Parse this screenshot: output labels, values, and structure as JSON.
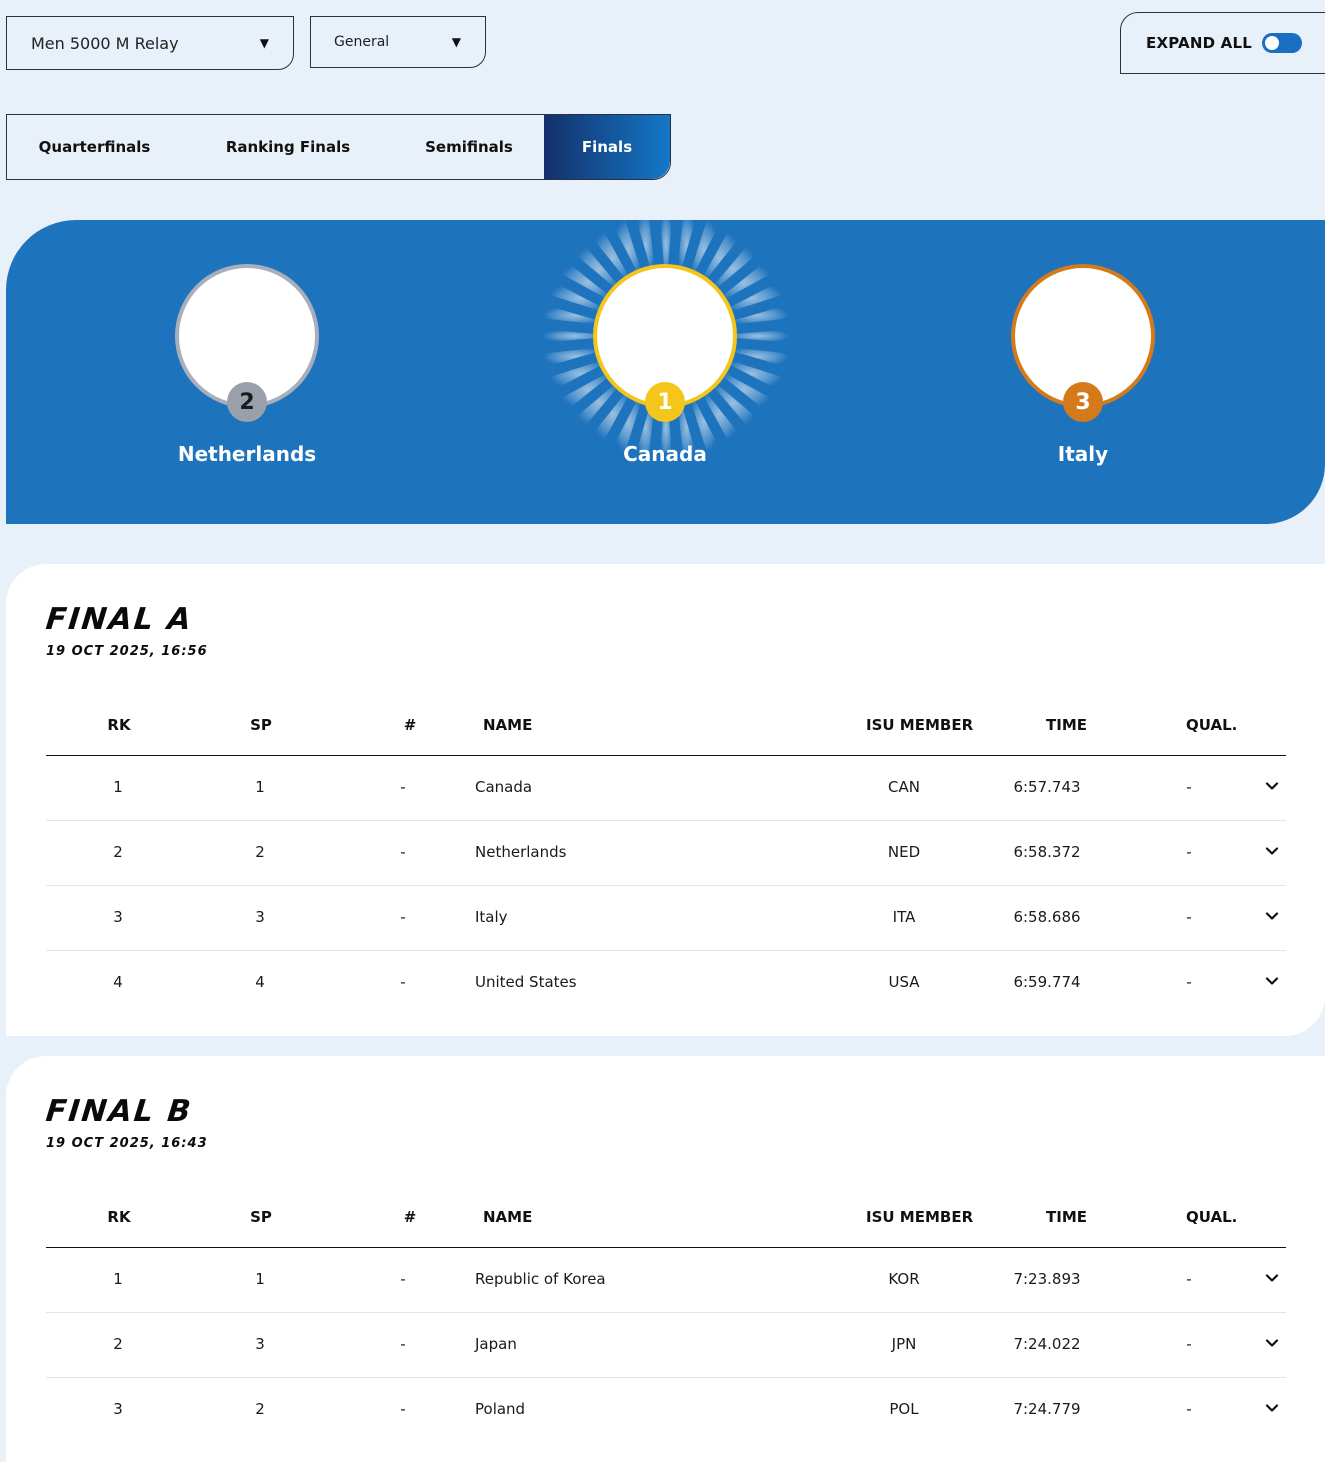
{
  "filters": {
    "event": "Men 5000 M Relay",
    "type": "General"
  },
  "expand_all": {
    "label": "EXPAND ALL",
    "on": true
  },
  "tabs": [
    "Quarterfinals",
    "Ranking Finals",
    "Semifinals",
    "Finals"
  ],
  "active_tab": "Finals",
  "podium": {
    "first": {
      "rank": "1",
      "name": "Canada"
    },
    "second": {
      "rank": "2",
      "name": "Netherlands"
    },
    "third": {
      "rank": "3",
      "name": "Italy"
    }
  },
  "columns": [
    "RK",
    "SP",
    "#",
    "NAME",
    "ISU MEMBER",
    "TIME",
    "QUAL."
  ],
  "final_a": {
    "title": "FINAL A",
    "date": "19 OCT 2025, 16:56",
    "rows": [
      {
        "rk": "1",
        "sp": "1",
        "num": "-",
        "name": "Canada",
        "member": "CAN",
        "time": "6:57.743",
        "qual": "-"
      },
      {
        "rk": "2",
        "sp": "2",
        "num": "-",
        "name": "Netherlands",
        "member": "NED",
        "time": "6:58.372",
        "qual": "-"
      },
      {
        "rk": "3",
        "sp": "3",
        "num": "-",
        "name": "Italy",
        "member": "ITA",
        "time": "6:58.686",
        "qual": "-"
      },
      {
        "rk": "4",
        "sp": "4",
        "num": "-",
        "name": "United States",
        "member": "USA",
        "time": "6:59.774",
        "qual": "-"
      }
    ]
  },
  "final_b": {
    "title": "FINAL B",
    "date": "19 OCT 2025, 16:43",
    "rows": [
      {
        "rk": "1",
        "sp": "1",
        "num": "-",
        "name": "Republic of Korea",
        "member": "KOR",
        "time": "7:23.893",
        "qual": "-"
      },
      {
        "rk": "2",
        "sp": "3",
        "num": "-",
        "name": "Japan",
        "member": "JPN",
        "time": "7:24.022",
        "qual": "-"
      },
      {
        "rk": "3",
        "sp": "2",
        "num": "-",
        "name": "Poland",
        "member": "POL",
        "time": "7:24.779",
        "qual": "-"
      }
    ]
  },
  "colors": {
    "background": "#e8f0f9",
    "podium_blue": "#1e73bd",
    "gold": "#f4c51a",
    "silver": "#9aa0ab",
    "bronze": "#d57a1b",
    "tab_active_from": "#14306a",
    "tab_active_to": "#1478c8"
  }
}
